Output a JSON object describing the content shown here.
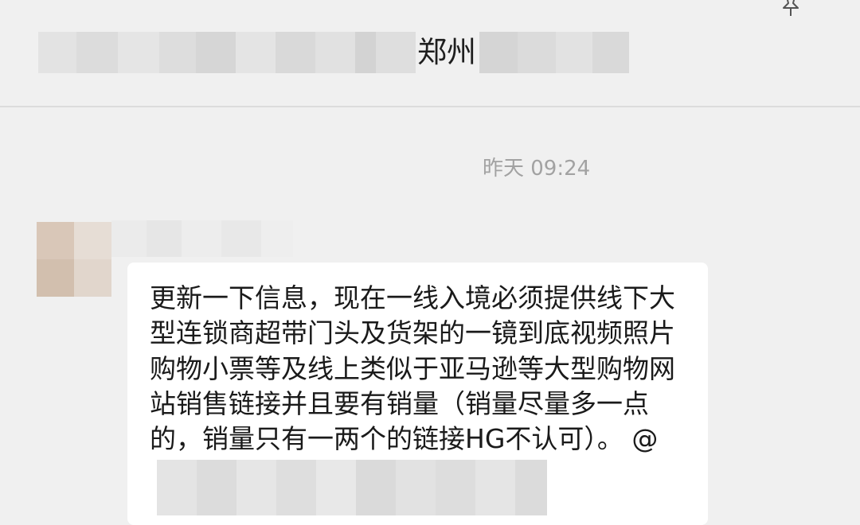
{
  "chat": {
    "title": "郑州",
    "icons": {
      "pin": "pin-icon"
    }
  },
  "messages": [
    {
      "timestamp": "昨天 09:24",
      "text": "更新一下信息，现在一线入境必须提供线下大型连锁商超带门头及货架的一镜到底视频照片购物小票等及线上类似于亚马逊等大型购物网站销售链接并且要有销量（销量尽量多一点的，销量只有一两个的链接HG不认可）。 @"
    }
  ],
  "colors": {
    "window_background": "#f0f0f0",
    "bubble_background": "#ffffff",
    "timestamp_text": "#a2a2a2",
    "message_text": "#1a1a1a"
  }
}
